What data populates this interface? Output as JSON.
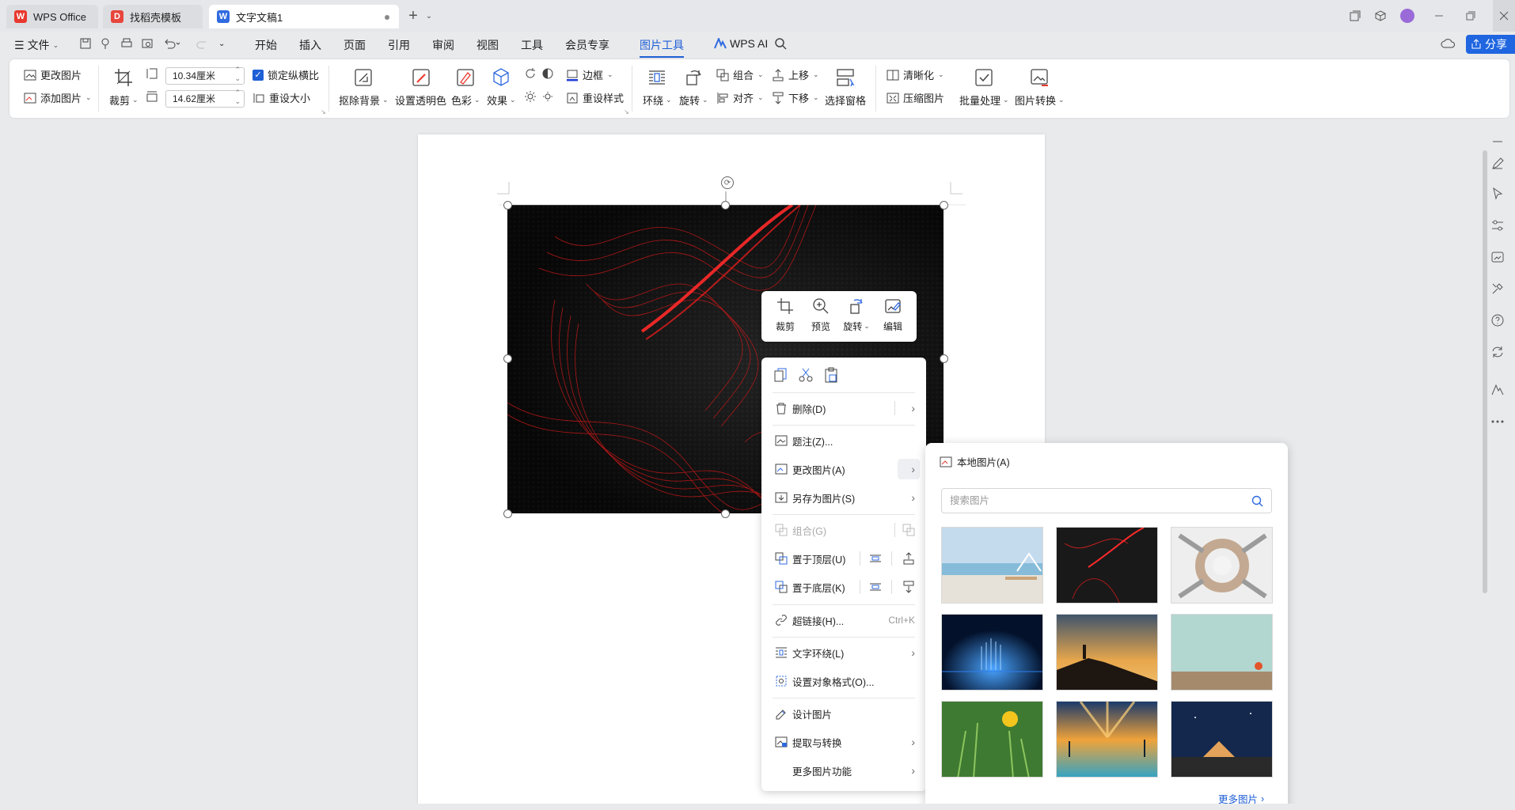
{
  "tabs": [
    {
      "label": "WPS Office",
      "icon": "wps-logo-icon"
    },
    {
      "label": "找稻壳模板",
      "icon": "docer-logo-icon"
    },
    {
      "label": "文字文稿1",
      "icon": "writer-doc-icon"
    }
  ],
  "menu": {
    "file": "文件",
    "items": [
      "开始",
      "插入",
      "页面",
      "引用",
      "审阅",
      "视图",
      "工具",
      "会员专享",
      "图片工具"
    ],
    "active": "图片工具",
    "wps_ai": "WPS AI",
    "share": "分享"
  },
  "ribbon": {
    "change_picture": "更改图片",
    "add_picture": "添加图片",
    "crop": "裁剪",
    "width": "10.34厘米",
    "height": "14.62厘米",
    "lock_ratio": "锁定纵横比",
    "reset_size": "重设大小",
    "remove_bg": "抠除背景",
    "set_transparent": "设置透明色",
    "color": "色彩",
    "effects": "效果",
    "border": "边框",
    "reset_style": "重设样式",
    "wrap": "环绕",
    "rotate": "旋转",
    "group": "组合",
    "align": "对齐",
    "bring_forward": "上移",
    "send_backward": "下移",
    "selection_pane": "选择窗格",
    "sharpen": "清晰化",
    "compress": "压缩图片",
    "batch": "批量处理",
    "convert": "图片转换"
  },
  "floatbar": {
    "crop": "裁剪",
    "preview": "预览",
    "rotate": "旋转",
    "edit": "编辑"
  },
  "context_menu": {
    "delete": "删除(D)",
    "caption": "题注(Z)...",
    "change_picture": "更改图片(A)",
    "save_as_picture": "另存为图片(S)",
    "group": "组合(G)",
    "bring_to_front": "置于顶层(U)",
    "send_to_back": "置于底层(K)",
    "hyperlink": "超链接(H)...",
    "hyperlink_shortcut": "Ctrl+K",
    "text_wrap": "文字环绕(L)",
    "format_object": "设置对象格式(O)...",
    "design_picture": "设计图片",
    "extract_convert": "提取与转换",
    "more_functions": "更多图片功能"
  },
  "submenu": {
    "local_picture": "本地图片(A)",
    "search_placeholder": "搜索图片",
    "more": "更多图片",
    "thumbnails": [
      {
        "name": "beach-pool",
        "colors": [
          "#bcd8ee",
          "#8ec0de",
          "#f0ede6"
        ]
      },
      {
        "name": "red-wave-dark",
        "colors": [
          "#1a1a1a",
          "#2a0c0c",
          "#c62020"
        ]
      },
      {
        "name": "hands-circle",
        "colors": [
          "#e8e8e8",
          "#bda896",
          "#f4f4f4"
        ]
      },
      {
        "name": "blue-tech-glow",
        "colors": [
          "#03112a",
          "#0a3b8c",
          "#4aa4ff"
        ]
      },
      {
        "name": "sunset-silhouette",
        "colors": [
          "#3e4f66",
          "#e8a74c",
          "#2a1e18"
        ]
      },
      {
        "name": "teal-wall-orange",
        "colors": [
          "#a9cfc9",
          "#cfe1dc",
          "#a08366"
        ]
      },
      {
        "name": "yellow-flower-grass",
        "colors": [
          "#1e4d22",
          "#5c9c3c",
          "#f0c21d"
        ]
      },
      {
        "name": "sun-rays-sea",
        "colors": [
          "#1b3a6b",
          "#f0a33a",
          "#2ea3c7"
        ]
      },
      {
        "name": "night-camp",
        "colors": [
          "#0c1a3a",
          "#24426e",
          "#e4a35a"
        ]
      }
    ]
  },
  "colors": {
    "accent": "#1f5fd6",
    "image_red": "#d81e1e"
  }
}
